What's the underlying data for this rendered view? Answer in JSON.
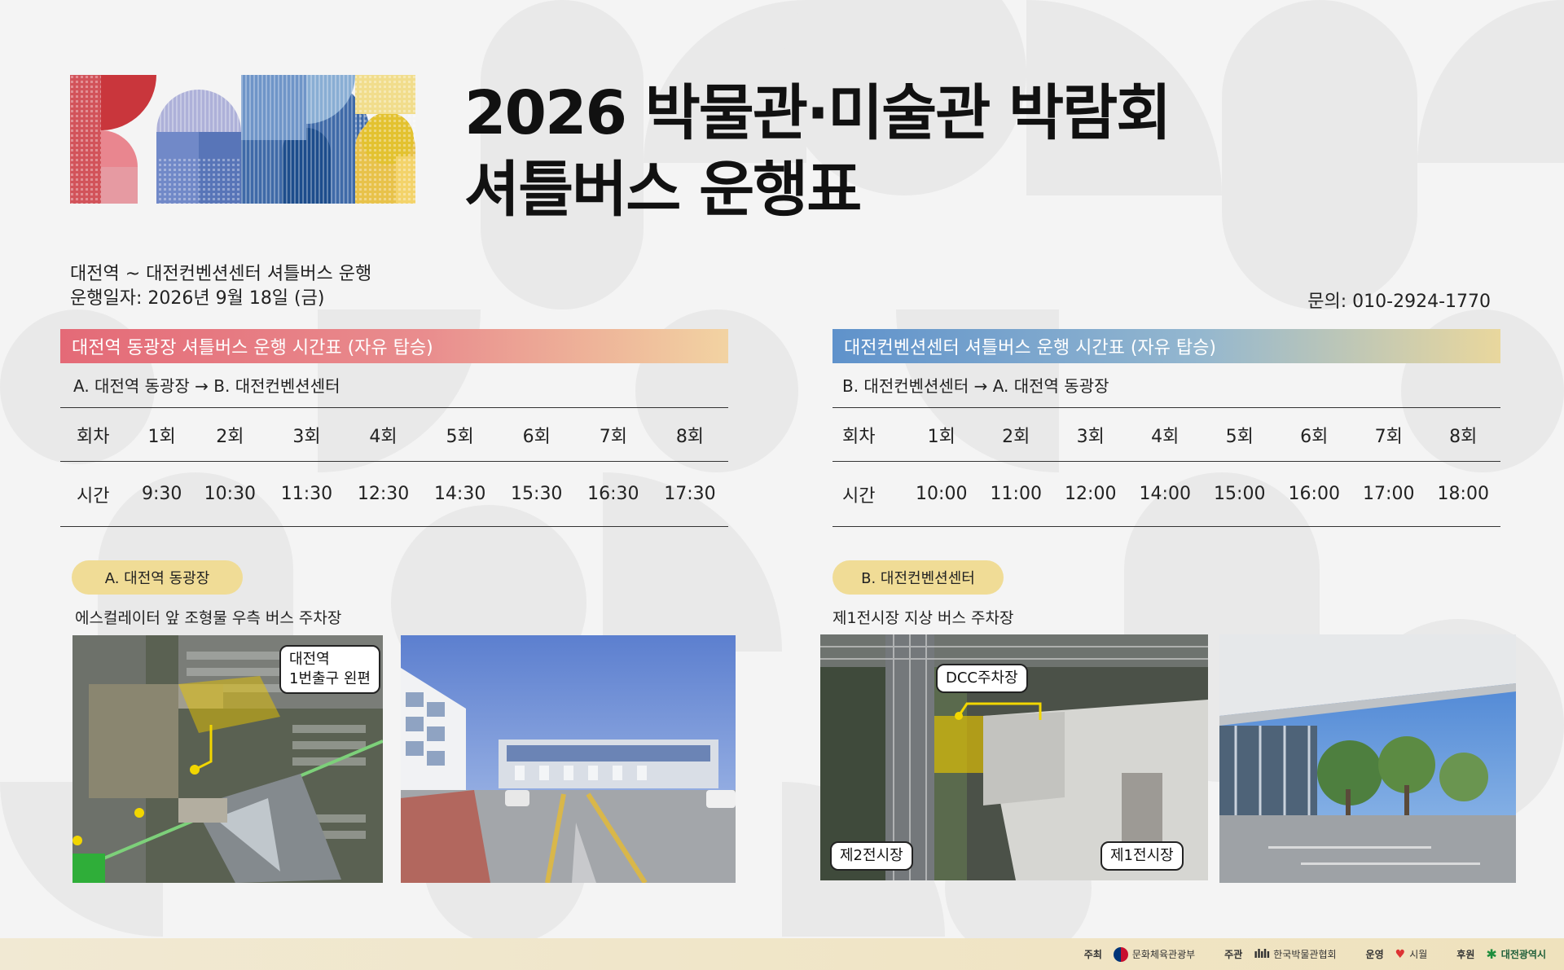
{
  "title": {
    "line1": "2026 박물관·미술관 박람회",
    "line2": "셔틀버스 운행표"
  },
  "info": {
    "line1": "대전역 ~ 대전컨벤션센터 셔틀버스 운행",
    "line2": "운행일자: 2026년 9월 18일 (금)"
  },
  "contact": "문의: 010-2924-1770",
  "left": {
    "banner": "대전역 동광장 셔틀버스 운행 시간표 (자유 탑승)",
    "route": "A. 대전역 동광장 →  B. 대전컨벤션센터",
    "header_label": "회차",
    "time_label": "시간",
    "runs": [
      "1회",
      "2회",
      "3회",
      "4회",
      "5회",
      "6회",
      "7회",
      "8회"
    ],
    "times": [
      "9:30",
      "10:30",
      "11:30",
      "12:30",
      "14:30",
      "15:30",
      "16:30",
      "17:30"
    ],
    "stop_pill": "A. 대전역 동광장",
    "stop_desc": "에스컬레이터 앞 조형물 우측 버스 주차장",
    "callout": {
      "line1": "대전역",
      "line2": "1번출구 왼편"
    }
  },
  "right": {
    "banner": "대전컨벤션센터 셔틀버스 운행 시간표 (자유 탑승)",
    "route": "B. 대전컨벤션센터 →  A. 대전역 동광장",
    "header_label": "회차",
    "time_label": "시간",
    "runs": [
      "1회",
      "2회",
      "3회",
      "4회",
      "5회",
      "6회",
      "7회",
      "8회"
    ],
    "times": [
      "10:00",
      "11:00",
      "12:00",
      "14:00",
      "15:00",
      "16:00",
      "17:00",
      "18:00"
    ],
    "stop_pill": "B. 대전컨벤션센터",
    "stop_desc": "제1전시장 지상 버스 주차장",
    "callouts": {
      "parking": "DCC주차장",
      "hall2": "제2전시장",
      "hall1": "제1전시장"
    }
  },
  "footer": {
    "host_label": "주최",
    "host": "문화체육관광부",
    "organizer_label": "주관",
    "organizer": "한국박물관협회",
    "operator_label": "운영",
    "operator": "시월",
    "sponsor_label": "후원",
    "sponsor": "대전광역시"
  },
  "colors": {
    "red_banner": "#e46a77",
    "blue_banner": "#5f92cb",
    "pill": "#f0dc96",
    "highlight": "#e6c400"
  }
}
